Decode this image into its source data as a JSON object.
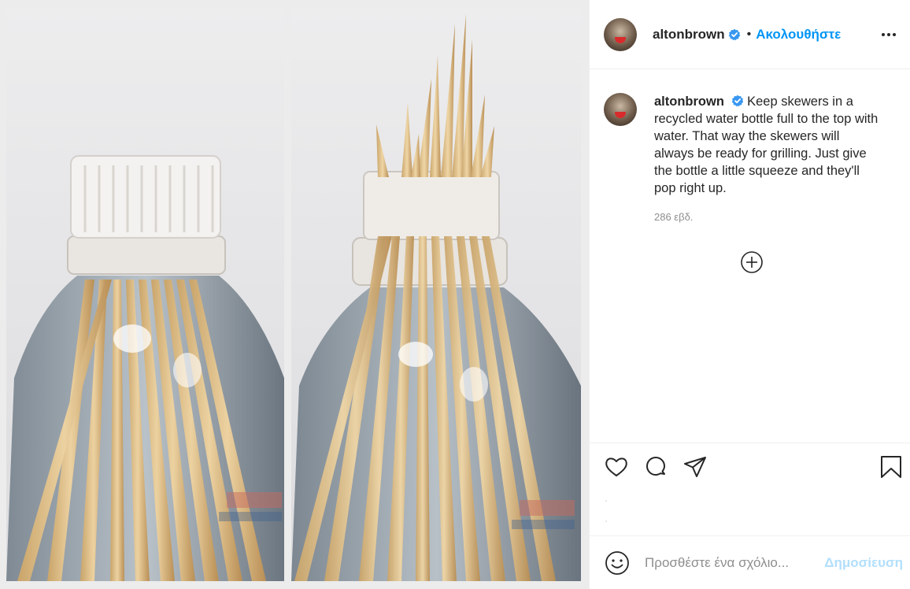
{
  "header": {
    "username": "altonbrown",
    "separator": "•",
    "follow_label": "Ακολουθήστε"
  },
  "caption": {
    "username": "altonbrown",
    "text": "Keep skewers in a recycled water bottle full to the top with water. That way the skewers will always be ready for grilling. Just give the bottle a little squeeze and they'll pop right up.",
    "timestamp": "286 εβδ."
  },
  "comment_box": {
    "placeholder": "Προσθέστε ένα σχόλιο...",
    "post_label": "Δημοσίευση"
  },
  "colors": {
    "accent": "#0095f6",
    "verified": "#3897f0",
    "muted_text": "#8e8e8e",
    "post_disabled": "#b2dffc"
  },
  "icons": [
    "verified-badge-icon",
    "more-options-icon",
    "load-more-comments-icon",
    "like-icon",
    "comment-icon",
    "share-icon",
    "save-icon",
    "emoji-icon"
  ]
}
